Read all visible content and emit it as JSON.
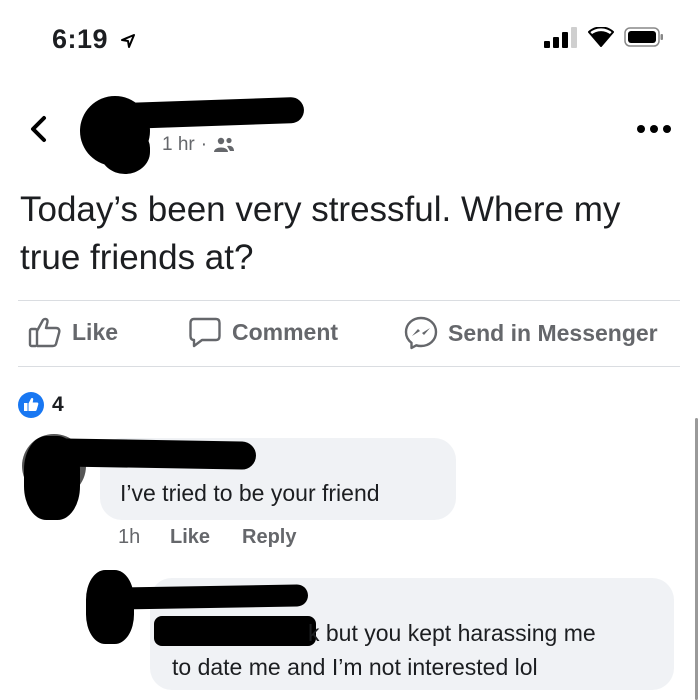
{
  "status_bar": {
    "time": "6:19"
  },
  "post": {
    "meta_time": "1 hr",
    "meta_separator": "·",
    "audience_icon": "friends-icon",
    "text": "Today’s been very stressful. Where my true friends at?",
    "actions": {
      "like": "Like",
      "comment": "Comment",
      "send": "Send in Messenger"
    },
    "reaction_count": "4"
  },
  "comments": [
    {
      "text": "I’ve tried to be your friend",
      "time": "1h",
      "like": "Like",
      "reply": "Reply"
    },
    {
      "text_line1_suffix": "k but you kept harassing me",
      "text_line2": "to date me and I’m not interested lol"
    }
  ],
  "colors": {
    "accent": "#1877f2",
    "muted": "#65676b",
    "bubble": "#f0f2f5"
  }
}
